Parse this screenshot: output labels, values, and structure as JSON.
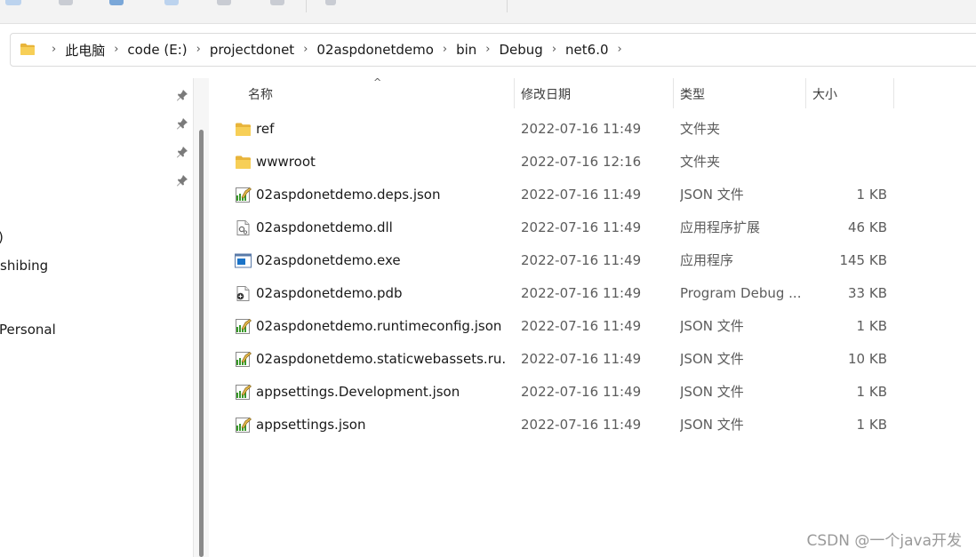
{
  "breadcrumb": [
    "此电脑",
    "code (E:)",
    "projectdonet",
    "02aspdonetdemo",
    "bin",
    "Debug",
    "net6.0"
  ],
  "nav": {
    "items": [
      ")",
      "shibing",
      "Personal"
    ]
  },
  "columns": {
    "name": "名称",
    "date": "修改日期",
    "type": "类型",
    "size": "大小"
  },
  "files": [
    {
      "name": "ref",
      "date": "2022-07-16 11:49",
      "type": "文件夹",
      "size": "",
      "icon": "folder-icon"
    },
    {
      "name": "wwwroot",
      "date": "2022-07-16 12:16",
      "type": "文件夹",
      "size": "",
      "icon": "folder-icon"
    },
    {
      "name": "02aspdonetdemo.deps.json",
      "date": "2022-07-16 11:49",
      "type": "JSON 文件",
      "size": "1 KB",
      "icon": "json-file-icon"
    },
    {
      "name": "02aspdonetdemo.dll",
      "date": "2022-07-16 11:49",
      "type": "应用程序扩展",
      "size": "46 KB",
      "icon": "dll-file-icon"
    },
    {
      "name": "02aspdonetdemo.exe",
      "date": "2022-07-16 11:49",
      "type": "应用程序",
      "size": "145 KB",
      "icon": "exe-file-icon"
    },
    {
      "name": "02aspdonetdemo.pdb",
      "date": "2022-07-16 11:49",
      "type": "Program Debug ...",
      "size": "33 KB",
      "icon": "pdb-file-icon"
    },
    {
      "name": "02aspdonetdemo.runtimeconfig.json",
      "date": "2022-07-16 11:49",
      "type": "JSON 文件",
      "size": "1 KB",
      "icon": "json-file-icon"
    },
    {
      "name": "02aspdonetdemo.staticwebassets.ru...",
      "date": "2022-07-16 11:49",
      "type": "JSON 文件",
      "size": "10 KB",
      "icon": "json-file-icon"
    },
    {
      "name": "appsettings.Development.json",
      "date": "2022-07-16 11:49",
      "type": "JSON 文件",
      "size": "1 KB",
      "icon": "json-file-icon"
    },
    {
      "name": "appsettings.json",
      "date": "2022-07-16 11:49",
      "type": "JSON 文件",
      "size": "1 KB",
      "icon": "json-file-icon"
    }
  ],
  "watermark": "CSDN @一个java开发",
  "colors": {
    "folder": "#f4c542",
    "accent": "#0a64c8",
    "json_green": "#3a9a2a"
  }
}
